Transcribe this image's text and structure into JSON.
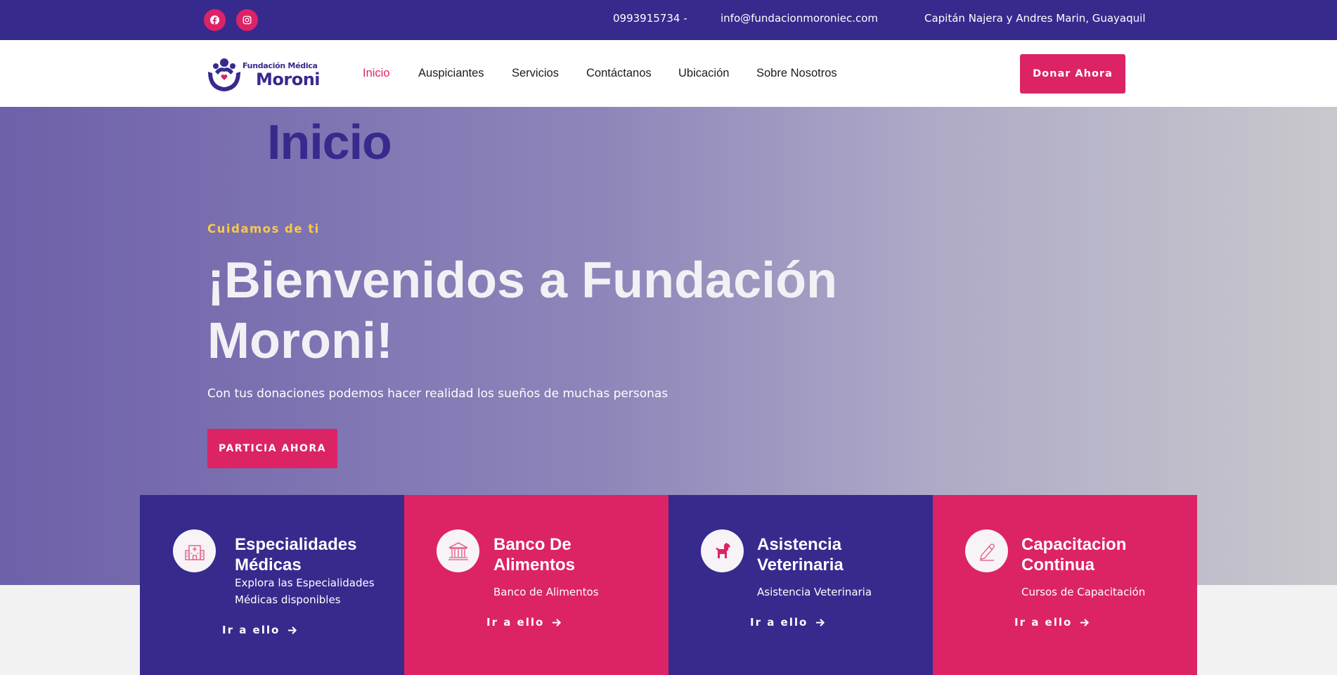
{
  "topbar": {
    "social": [
      {
        "icon": "facebook-icon"
      },
      {
        "icon": "instagram-icon"
      }
    ],
    "phone": "0993915734 -",
    "email": "info@fundacionmoroniec.com",
    "address": "Capitán Najera y Andres Marin, Guayaquil"
  },
  "logo": {
    "line1": "Fundación Médica",
    "line2": "Moroni"
  },
  "nav": {
    "items": [
      {
        "label": "Inicio",
        "active": true
      },
      {
        "label": "Auspiciantes"
      },
      {
        "label": "Servicios"
      },
      {
        "label": "Contáctanos"
      },
      {
        "label": "Ubicación"
      },
      {
        "label": "Sobre Nosotros"
      }
    ],
    "donate_label": "Donar Ahora"
  },
  "hero": {
    "page_title": "Inicio",
    "tagline": "Cuidamos de ti",
    "title": "¡Bienvenidos a Fundación Moroni!",
    "subtitle": "Con tus donaciones podemos hacer realidad los sueños de muchas personas",
    "button_label": "PARTICIA AHORA"
  },
  "cards": [
    {
      "title": "Especialidades Médicas",
      "description": "Explora las Especialidades Médicas disponibles",
      "link": "Ir a ello",
      "icon": "hospital-icon",
      "color": "#372a8d"
    },
    {
      "title": "Banco De Alimentos",
      "description": "Banco de Alimentos",
      "link": "Ir a ello",
      "icon": "bank-icon",
      "color": "#dc2366"
    },
    {
      "title": "Asistencia Veterinaria",
      "description": "Asistencia Veterinaria",
      "link": "Ir a ello",
      "icon": "dog-icon",
      "color": "#372a8d"
    },
    {
      "title": "Capacitacion Continua",
      "description": "Cursos de Capacitación",
      "link": "Ir a ello",
      "icon": "pencil-icon",
      "color": "#dc2366"
    }
  ],
  "colors": {
    "primary_purple": "#372a8d",
    "accent_pink": "#dc2366",
    "tag_yellow": "#f7ca46"
  }
}
